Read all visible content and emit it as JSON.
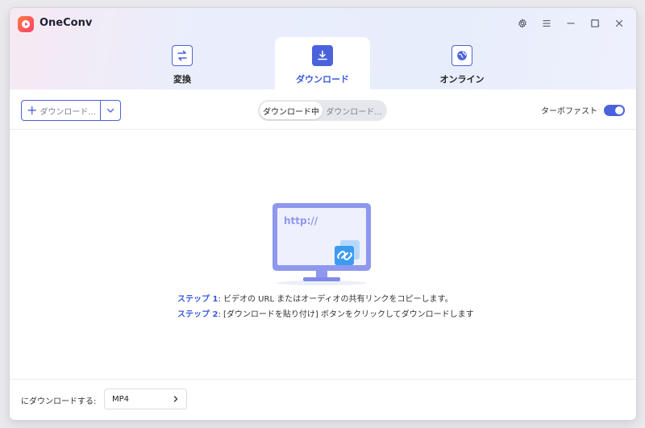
{
  "app": {
    "title": "OneConv"
  },
  "tabs": [
    {
      "label": "変換",
      "icon": "swap-arrows-icon",
      "active": false
    },
    {
      "label": "ダウンロード",
      "icon": "download-icon",
      "active": true
    },
    {
      "label": "オンライン",
      "icon": "globe-icon",
      "active": false
    }
  ],
  "toolbar": {
    "download_button_label": "ダウンロード...",
    "segments": [
      "ダウンロード中",
      "ダウンロード..."
    ],
    "turbo_label": "ターボファスト",
    "turbo_on": true
  },
  "illustration": {
    "screen_text": "http://"
  },
  "steps": [
    {
      "prefix": "ステップ 1",
      "text": ": ビデオの URL またはオーディオの共有リンクをコピーします。"
    },
    {
      "prefix": "ステップ 2",
      "text": ": [ダウンロードを貼り付け] ボタンをクリックしてダウンロードします"
    }
  ],
  "footer": {
    "label": "にダウンロードする:",
    "format": "MP4"
  },
  "colors": {
    "accent": "#4a63dd",
    "monitor": "#8e98ef"
  }
}
